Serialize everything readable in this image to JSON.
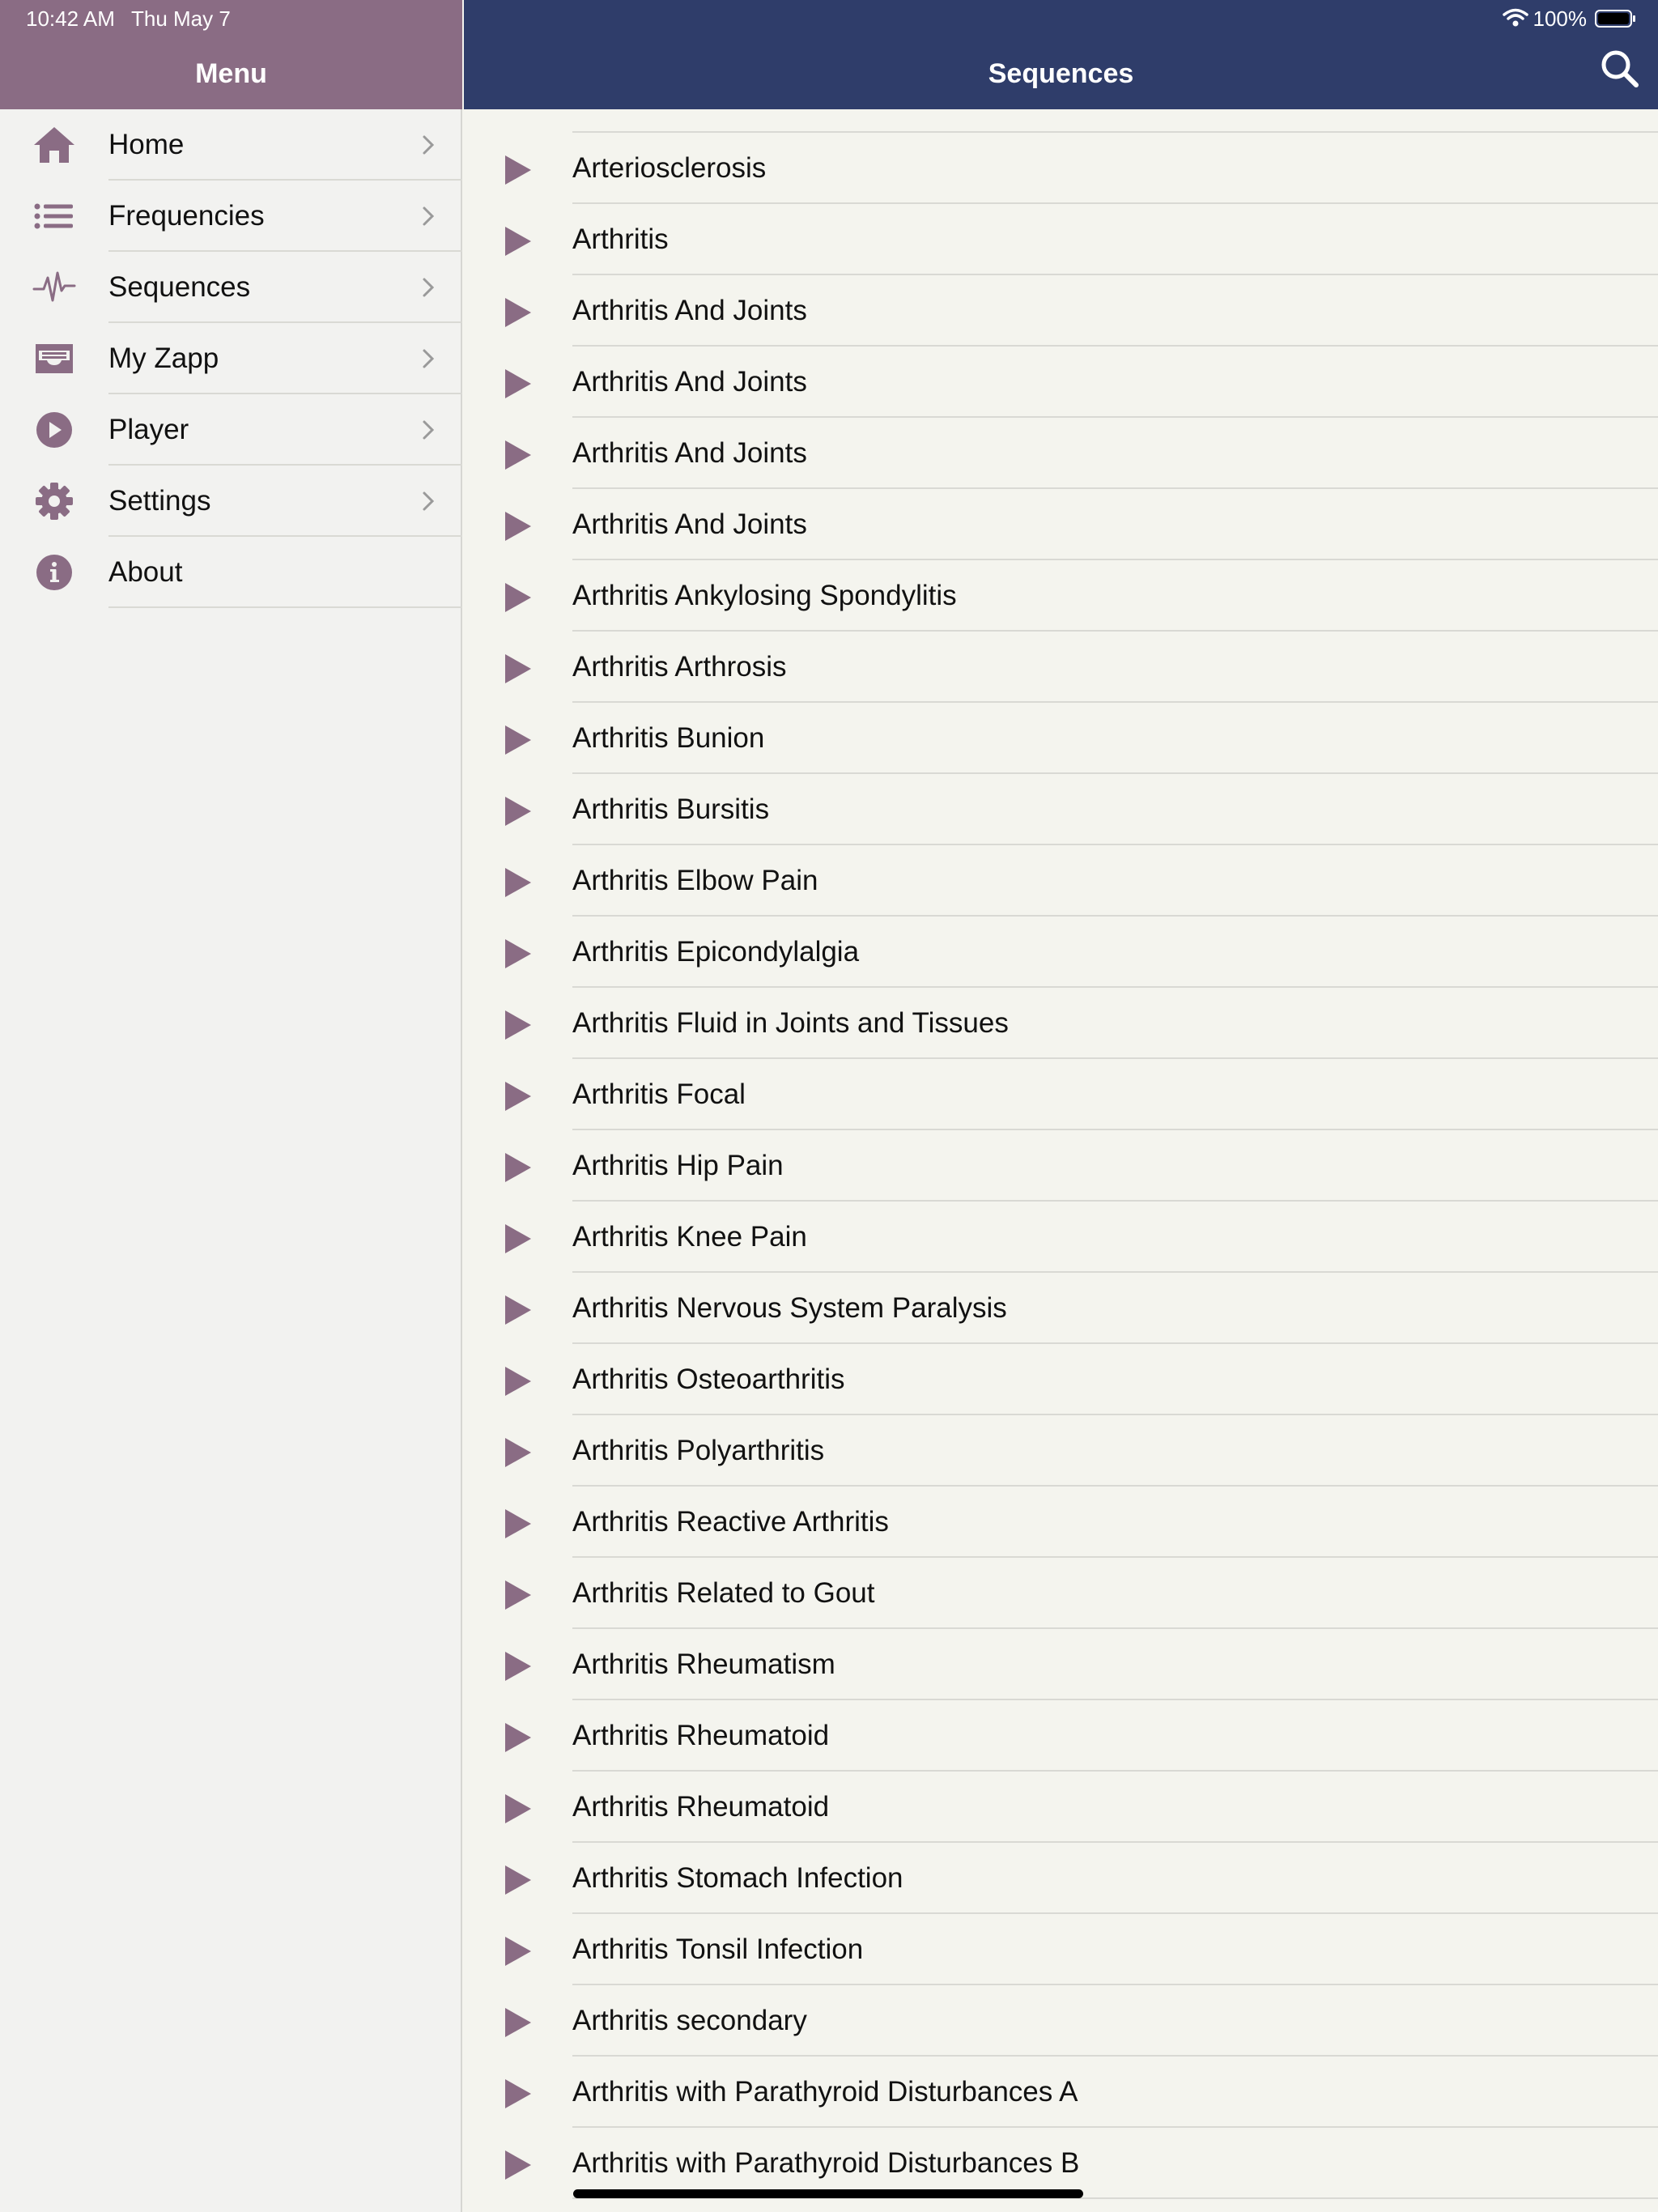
{
  "status_bar": {
    "time": "10:42 AM",
    "date": "Thu May 7",
    "battery": "100%"
  },
  "colors": {
    "menu_header": "#8a6c84",
    "content_header": "#2f3d6a",
    "accent": "#8a6c84"
  },
  "menu": {
    "title": "Menu",
    "items": [
      {
        "label": "Home",
        "icon": "home-icon",
        "chevron": true
      },
      {
        "label": "Frequencies",
        "icon": "list-icon",
        "chevron": true
      },
      {
        "label": "Sequences",
        "icon": "waveform-icon",
        "chevron": true
      },
      {
        "label": "My Zapp",
        "icon": "inbox-tray-icon",
        "chevron": true
      },
      {
        "label": "Player",
        "icon": "play-circle-icon",
        "chevron": true
      },
      {
        "label": "Settings",
        "icon": "gear-icon",
        "chevron": true
      },
      {
        "label": "About",
        "icon": "info-icon",
        "chevron": false
      }
    ]
  },
  "content": {
    "title": "Sequences",
    "search_icon": "search-icon",
    "sequences": [
      "Arteriosclerosis",
      "Arthritis",
      "Arthritis And Joints",
      "Arthritis And Joints",
      "Arthritis And Joints",
      "Arthritis And Joints",
      "Arthritis Ankylosing Spondylitis",
      "Arthritis Arthrosis",
      "Arthritis Bunion",
      "Arthritis Bursitis",
      "Arthritis Elbow Pain",
      "Arthritis Epicondylalgia",
      "Arthritis Fluid in Joints and Tissues",
      "Arthritis Focal",
      "Arthritis Hip Pain",
      "Arthritis Knee Pain",
      "Arthritis Nervous System Paralysis",
      "Arthritis Osteoarthritis",
      "Arthritis Polyarthritis",
      "Arthritis Reactive Arthritis",
      "Arthritis Related to Gout",
      "Arthritis Rheumatism",
      "Arthritis Rheumatoid",
      "Arthritis Rheumatoid",
      "Arthritis Stomach Infection",
      "Arthritis Tonsil Infection",
      "Arthritis secondary",
      "Arthritis with Parathyroid Disturbances A",
      "Arthritis with Parathyroid Disturbances B"
    ]
  }
}
